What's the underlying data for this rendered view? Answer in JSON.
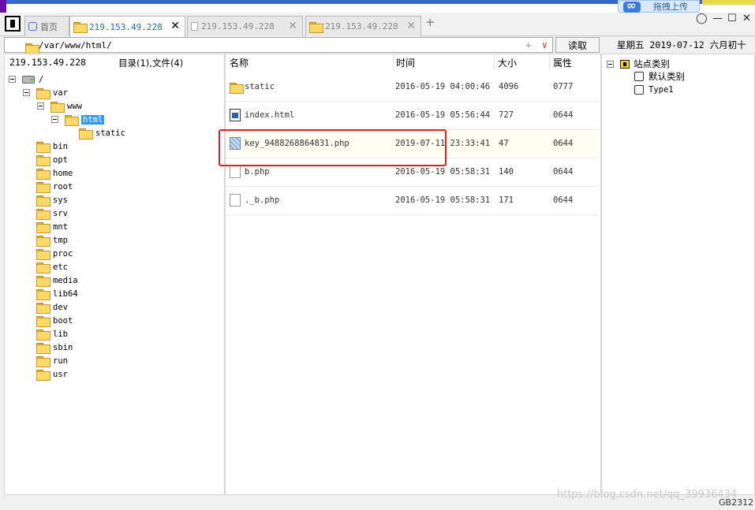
{
  "tabs": [
    {
      "label": "首页",
      "icon": "home-page-icon"
    },
    {
      "label": "219.153.49.228",
      "icon": "folder-icon",
      "active": true
    },
    {
      "label": "219.153.49.228",
      "icon": "document-icon"
    },
    {
      "label": "219.153.49.228",
      "icon": "folder-icon"
    }
  ],
  "add_tab_label": "+",
  "close_label": "✕",
  "upload_button": {
    "label": "拖拽上传"
  },
  "window_controls": {
    "restore": "◯",
    "minimize": "—",
    "maximize": "☐",
    "close": "✕"
  },
  "address": {
    "path": "/var/www/html/",
    "add_label": "+",
    "dropdown_label": "∨"
  },
  "read_button": "读取",
  "date_text": "星期五 2019-07-12 六月初十",
  "left_header": {
    "host": "219.153.49.228",
    "summary": "目录(1),文件(4)"
  },
  "tree": [
    {
      "label": "/",
      "level": 0,
      "toggle": true,
      "icon": "drive"
    },
    {
      "label": "var",
      "level": 1,
      "toggle": true,
      "icon": "folder"
    },
    {
      "label": "www",
      "level": 2,
      "toggle": true,
      "icon": "folder"
    },
    {
      "label": "html",
      "level": 3,
      "toggle": true,
      "icon": "folder",
      "selected": true
    },
    {
      "label": "static",
      "level": 4,
      "toggle": false,
      "icon": "folder"
    },
    {
      "label": "bin",
      "level": 1,
      "toggle": false,
      "icon": "folder"
    },
    {
      "label": "opt",
      "level": 1,
      "toggle": false,
      "icon": "folder"
    },
    {
      "label": "home",
      "level": 1,
      "toggle": false,
      "icon": "folder"
    },
    {
      "label": "root",
      "level": 1,
      "toggle": false,
      "icon": "folder"
    },
    {
      "label": "sys",
      "level": 1,
      "toggle": false,
      "icon": "folder"
    },
    {
      "label": "srv",
      "level": 1,
      "toggle": false,
      "icon": "folder"
    },
    {
      "label": "mnt",
      "level": 1,
      "toggle": false,
      "icon": "folder"
    },
    {
      "label": "tmp",
      "level": 1,
      "toggle": false,
      "icon": "folder"
    },
    {
      "label": "proc",
      "level": 1,
      "toggle": false,
      "icon": "folder"
    },
    {
      "label": "etc",
      "level": 1,
      "toggle": false,
      "icon": "folder"
    },
    {
      "label": "media",
      "level": 1,
      "toggle": false,
      "icon": "folder"
    },
    {
      "label": "lib64",
      "level": 1,
      "toggle": false,
      "icon": "folder"
    },
    {
      "label": "dev",
      "level": 1,
      "toggle": false,
      "icon": "folder"
    },
    {
      "label": "boot",
      "level": 1,
      "toggle": false,
      "icon": "folder"
    },
    {
      "label": "lib",
      "level": 1,
      "toggle": false,
      "icon": "folder"
    },
    {
      "label": "sbin",
      "level": 1,
      "toggle": false,
      "icon": "folder"
    },
    {
      "label": "run",
      "level": 1,
      "toggle": false,
      "icon": "folder"
    },
    {
      "label": "usr",
      "level": 1,
      "toggle": false,
      "icon": "folder"
    }
  ],
  "columns": {
    "name": "名称",
    "time": "时间",
    "size": "大小",
    "attr": "属性"
  },
  "files": [
    {
      "name": "static",
      "time": "2016-05-19 04:00:46",
      "size": "4096",
      "attr": "0777",
      "icon": "folder"
    },
    {
      "name": "index.html",
      "time": "2016-05-19 05:56:44",
      "size": "727",
      "attr": "0644",
      "icon": "html"
    },
    {
      "name": "key_9488268864831.php",
      "time": "2019-07-11 23:33:41",
      "size": "47",
      "attr": "0644",
      "icon": "phpk",
      "highlight": true
    },
    {
      "name": "b.php",
      "time": "2016-05-19 05:58:31",
      "size": "140",
      "attr": "0644",
      "icon": "doc"
    },
    {
      "name": "._b.php",
      "time": "2016-05-19 05:58:31",
      "size": "171",
      "attr": "0644",
      "icon": "doc"
    }
  ],
  "site_tree": {
    "root": "站点类别",
    "items": [
      {
        "label": "默认类别",
        "mono": false
      },
      {
        "label": "Type1",
        "mono": true
      }
    ]
  },
  "watermark": "https://blog.csdn.net/qq_39936434",
  "status_charset": "GB2312",
  "colors": {
    "selection": "#3399ff",
    "active_tab_text": "#1a6fd0",
    "annotation_box": "#e02020"
  }
}
